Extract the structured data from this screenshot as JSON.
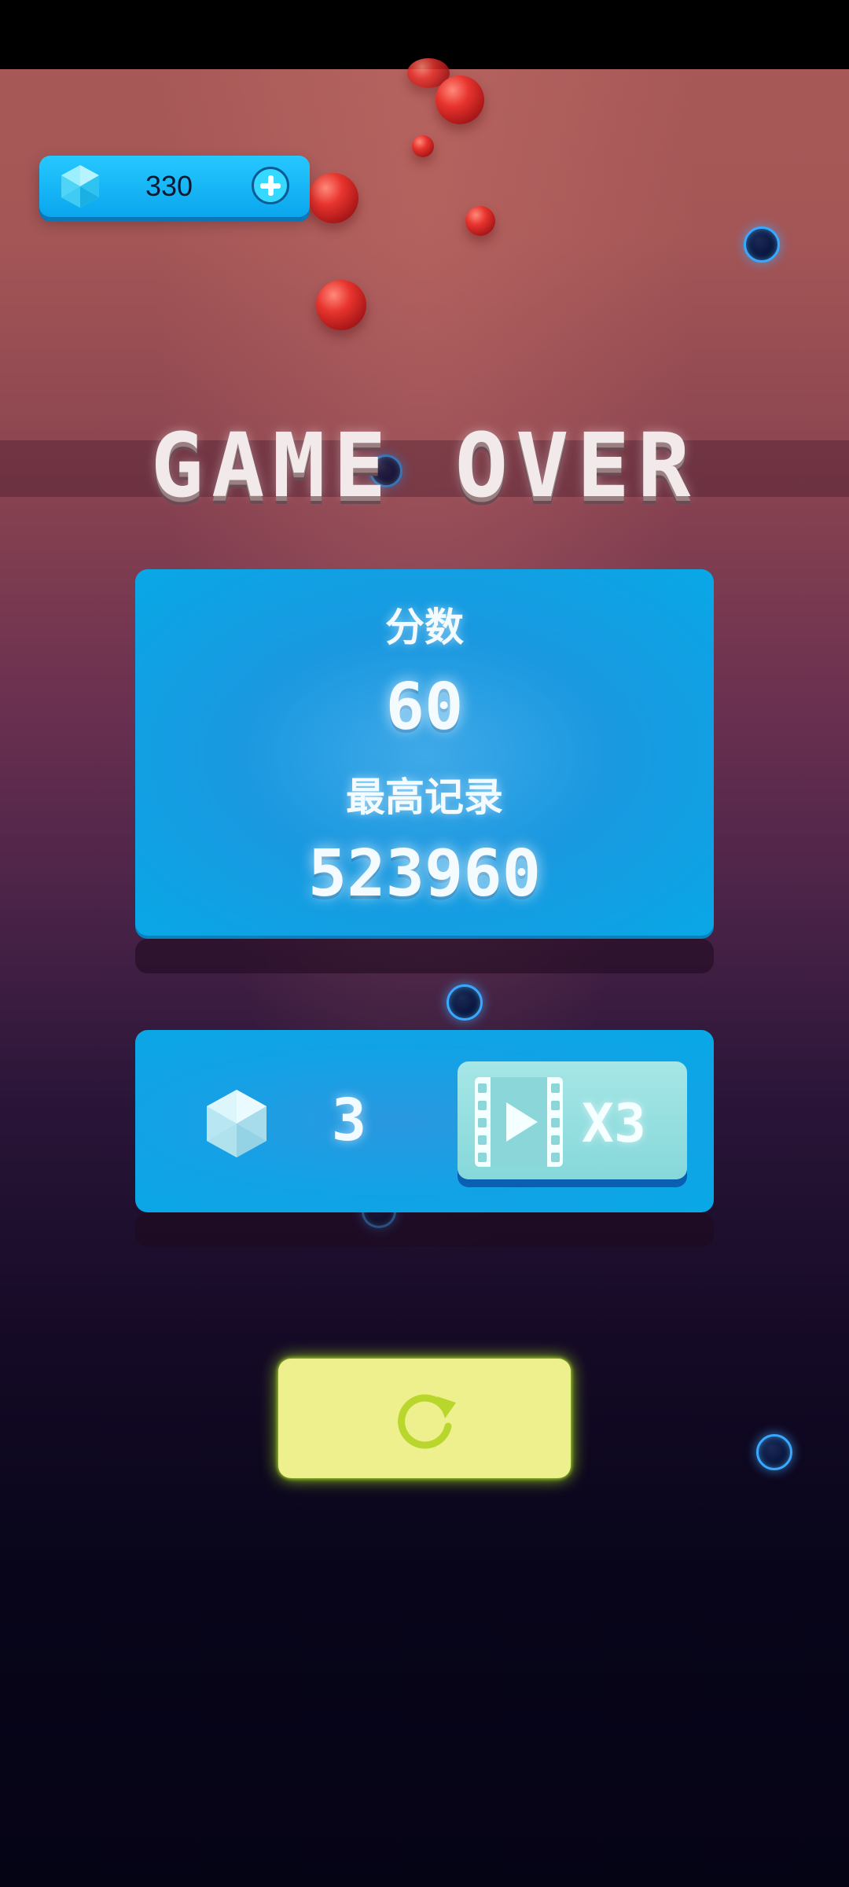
{
  "colors": {
    "panel_blue": "#0aa6e6",
    "restart_yellow": "#eef08e",
    "restart_icon_green": "#b8d62c",
    "video_button_teal": "#86d8da",
    "ball_red": "#e8342e",
    "ball_blue_rim": "#3aa8ff"
  },
  "hud": {
    "gem_icon": "gem-icon",
    "gem_count": "330",
    "add_icon": "plus-icon"
  },
  "title": "GAME OVER",
  "score_panel": {
    "score_label": "分数",
    "score_value": "60",
    "best_label": "最高记录",
    "best_value": "523960"
  },
  "reward_panel": {
    "gem_icon": "gem-icon",
    "reward_count": "3",
    "video_icon": "film-play-icon",
    "multiplier": "X3"
  },
  "restart": {
    "icon": "restart-icon"
  }
}
